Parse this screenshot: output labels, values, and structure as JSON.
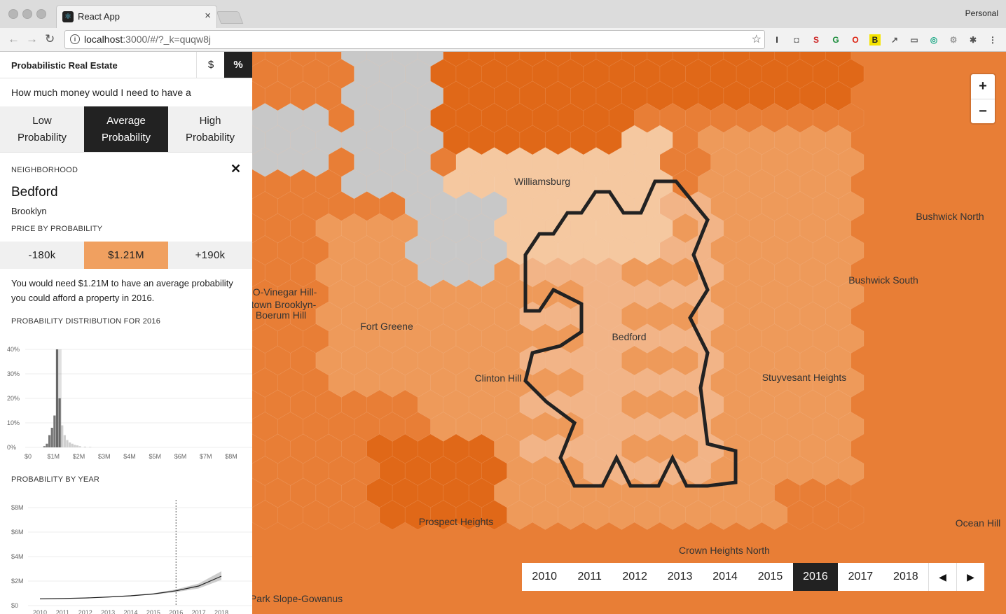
{
  "browser": {
    "tab_title": "React App",
    "tab_close": "×",
    "profile": "Personal",
    "url_host": "localhost",
    "url_rest": ":3000/#/?_k=quqw8j",
    "back_icon": "←",
    "forward_icon": "→",
    "reload_icon": "↻",
    "extensions": [
      "I",
      "◘",
      "S",
      "G",
      "O",
      "B",
      "↗",
      "▭",
      "◎",
      "⚙",
      "✱",
      "⋮"
    ]
  },
  "sidebar": {
    "title": "Probabilistic Real Estate",
    "mode_dollar": "$",
    "mode_percent": "%",
    "question": "How much money would I need to have a",
    "prob_buttons": [
      {
        "label": "Low Probability",
        "active": false
      },
      {
        "label": "Average Probability",
        "active": true
      },
      {
        "label": "High Probability",
        "active": false
      }
    ],
    "neighborhood_label": "NEIGHBORHOOD",
    "close": "✕",
    "neighborhood": "Bedford",
    "borough": "Brooklyn",
    "price_label": "PRICE BY PROBABILITY",
    "price_buttons": [
      {
        "label": "-180k",
        "active": false
      },
      {
        "label": "$1.21M",
        "active": true
      },
      {
        "label": "+190k",
        "active": false
      }
    ],
    "summary": "You would need $1.21M to have an average probability you could afford a property in 2016.",
    "dist_label": "PROBABILITY DISTRIBUTION FOR 2016",
    "year_label": "PROBABILITY BY YEAR"
  },
  "chart_data": [
    {
      "type": "bar",
      "title": "PROBABILITY DISTRIBUTION FOR 2016",
      "xlabel": "",
      "ylabel": "",
      "x_ticks": [
        "$0",
        "$1M",
        "$2M",
        "$3M",
        "$4M",
        "$5M",
        "$6M",
        "$7M",
        "$8M"
      ],
      "y_ticks": [
        "40%",
        "30%",
        "20%",
        "10%",
        "0%"
      ],
      "xlim": [
        0,
        8000000
      ],
      "ylim": [
        0,
        40
      ],
      "bins_x_millions": [
        0.6,
        0.7,
        0.8,
        0.9,
        1.0,
        1.1,
        1.2,
        1.3,
        1.4,
        1.5,
        1.6,
        1.7,
        1.8,
        1.9,
        2.0,
        2.2,
        2.4
      ],
      "values_percent": [
        0.5,
        1.5,
        5,
        8,
        13,
        40,
        20,
        9,
        5,
        3,
        2,
        1.5,
        1,
        0.8,
        0.5,
        0.3,
        0.2
      ],
      "marker_x_millions": 1.21
    },
    {
      "type": "line",
      "title": "PROBABILITY BY YEAR",
      "x_ticks": [
        "2010",
        "2011",
        "2012",
        "2013",
        "2014",
        "2015",
        "2016",
        "2017",
        "2018"
      ],
      "y_ticks": [
        "$8M",
        "$6M",
        "$4M",
        "$2M",
        "$0"
      ],
      "ylim": [
        0,
        8000000
      ],
      "series": [
        {
          "x": [
            2010,
            2011,
            2012,
            2013,
            2014,
            2015,
            2016,
            2017,
            2018
          ],
          "values_millions": [
            0.55,
            0.58,
            0.62,
            0.7,
            0.8,
            0.95,
            1.21,
            1.6,
            2.4
          ],
          "band_low_millions": [
            0.55,
            0.57,
            0.6,
            0.67,
            0.76,
            0.9,
            1.1,
            1.4,
            2.1
          ],
          "band_high_millions": [
            0.55,
            0.59,
            0.64,
            0.73,
            0.84,
            1.0,
            1.32,
            1.8,
            2.8
          ]
        }
      ],
      "marker_year": 2016
    }
  ],
  "map": {
    "colors": {
      "dark": "#e06818",
      "mid": "#e87e36",
      "light": "#ee9a5a",
      "pale": "#f2b487",
      "cream": "#f5c8a0",
      "gray": "#c8c8c8"
    },
    "labels": [
      {
        "text": "Williamsburg"
      },
      {
        "text": "Bushwick North"
      },
      {
        "text": "Bushwick South"
      },
      {
        "text": "MBO-Vinegar Hill-"
      },
      {
        "text": "wntown Brooklyn-"
      },
      {
        "text": "Boerum Hill"
      },
      {
        "text": "Fort Greene"
      },
      {
        "text": "Bedford"
      },
      {
        "text": "Clinton Hill"
      },
      {
        "text": "Stuyvesant Heights"
      },
      {
        "text": "Prospect Heights"
      },
      {
        "text": "Crown Heights North"
      },
      {
        "text": "Ocean Hill"
      },
      {
        "text": "Park Slope-Gowanus"
      }
    ],
    "zoom_in": "+",
    "zoom_out": "−",
    "years": [
      {
        "label": "2010",
        "active": false
      },
      {
        "label": "2011",
        "active": false
      },
      {
        "label": "2012",
        "active": false
      },
      {
        "label": "2013",
        "active": false
      },
      {
        "label": "2014",
        "active": false
      },
      {
        "label": "2015",
        "active": false
      },
      {
        "label": "2016",
        "active": true
      },
      {
        "label": "2017",
        "active": false
      },
      {
        "label": "2018",
        "active": false
      }
    ],
    "prev_icon": "◀",
    "next_icon": "▶"
  }
}
